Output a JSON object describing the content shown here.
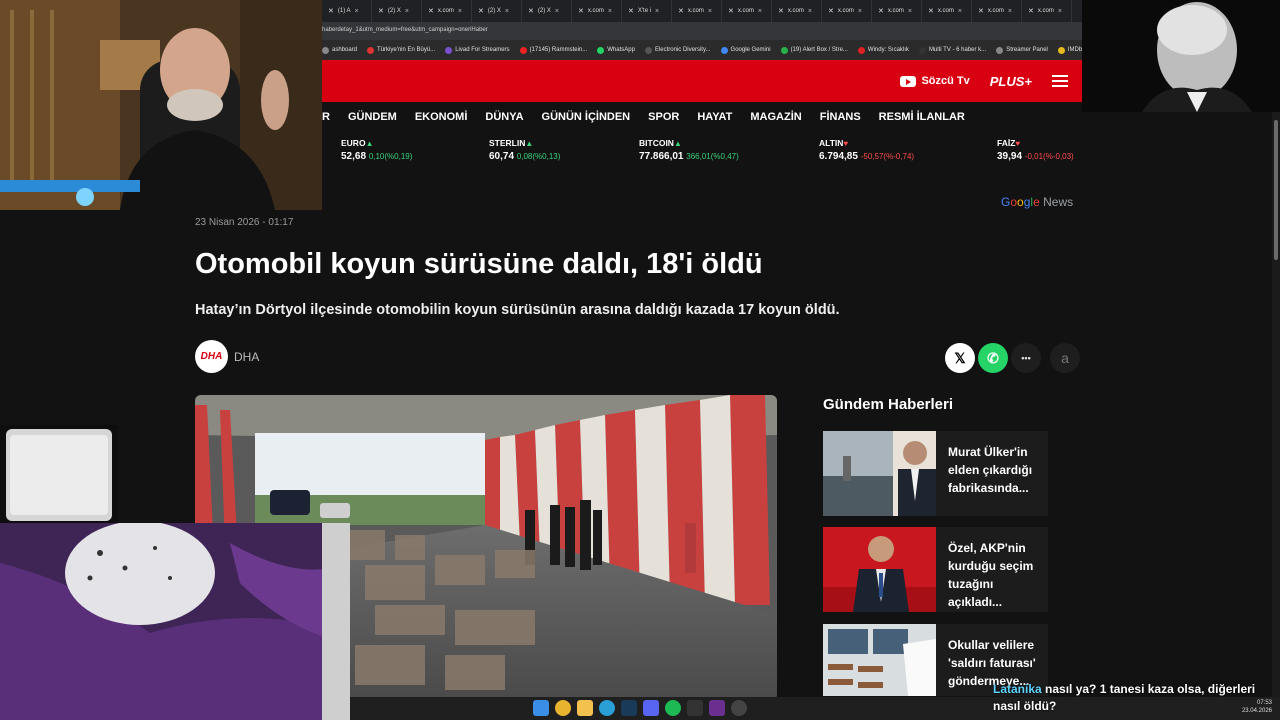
{
  "browser": {
    "tabs": [
      "(1) A",
      "(2) X",
      "x.com",
      "(2) X",
      "(2) X",
      "x.com",
      "X'te i",
      "x.com",
      "x.com",
      "x.com",
      "x.com",
      "x.com",
      "x.com",
      "x.com",
      "x.com"
    ],
    "url": "haberdetay_1&utm_medium=free&utm_campaign=oneriHaber",
    "bookmarks": [
      "ashboard",
      "Türkiye'nin En Büyü...",
      "Livad For Streamers",
      "(17145) Rammstein...",
      "WhatsApp",
      "Electronic Diversity...",
      "Google Gemini",
      "(19) Alert Box / Stre...",
      "Windy: Sıcaklık",
      "Multi TV - 6 haber k...",
      "Streamer Panel",
      "IMDb: Ratings"
    ]
  },
  "header": {
    "sozcu_tv": "Sözcü Tv",
    "plus": "PLUS+",
    "nav": [
      "R",
      "GÜNDEM",
      "EKONOMİ",
      "DÜNYA",
      "GÜNÜN İÇİNDEN",
      "SPOR",
      "HAYAT",
      "MAGAZİN",
      "FİNANS",
      "RESMİ İLANLAR"
    ]
  },
  "ticker": [
    {
      "name": "EURO",
      "arrow": "▲",
      "value": "52,68",
      "change": "0,10(%0,19)",
      "dir": "up"
    },
    {
      "name": "STERLIN",
      "arrow": "▲",
      "value": "60,74",
      "change": "0,08(%0,13)",
      "dir": "up"
    },
    {
      "name": "BITCOIN",
      "arrow": "▲",
      "value": "77.866,01",
      "change": "366,01(%0,47)",
      "dir": "up"
    },
    {
      "name": "ALTIN",
      "arrow": "♥",
      "value": "6.794,85",
      "change": "-50,57(%-0,74)",
      "dir": "down"
    },
    {
      "name": "FAİZ",
      "arrow": "♥",
      "value": "39,94",
      "change": "-0,01(%-0,03)",
      "dir": "down"
    }
  ],
  "google_news": {
    "g": "G",
    "o1": "o",
    "o2": "o",
    "g2": "g",
    "l": "l",
    "e": "e",
    "news": "News"
  },
  "article": {
    "date": "23 Nisan 2026 - 01:17",
    "title": "Otomobil koyun sürüsüne daldı, 18'i öldü",
    "lead": "Hatay’ın Dörtyol ilçesinde otomobilin koyun sürüsünün arasına daldığı kazada 17 koyun öldü.",
    "source_logo": "DHA",
    "source": "DHA",
    "share": {
      "x": "𝕏",
      "whatsapp": "✆",
      "more": "•••",
      "font": "a"
    }
  },
  "sidebar": {
    "title": "Gündem Haberleri",
    "items": [
      {
        "text": "Murat Ülker'in elden çıkardığı fabrikasında..."
      },
      {
        "text": "Özel, AKP'nin kurduğu seçim tuzağını açıkladı..."
      },
      {
        "text": "Okullar velilere 'saldırı faturası' göndermeye..."
      }
    ]
  },
  "chat": {
    "user": "Latanika",
    "message": "nasıl ya? 1 tanesi kaza olsa, diğerleri nasıl öldü?"
  },
  "tray": {
    "time": "07:53",
    "date": "23.04.2026"
  }
}
